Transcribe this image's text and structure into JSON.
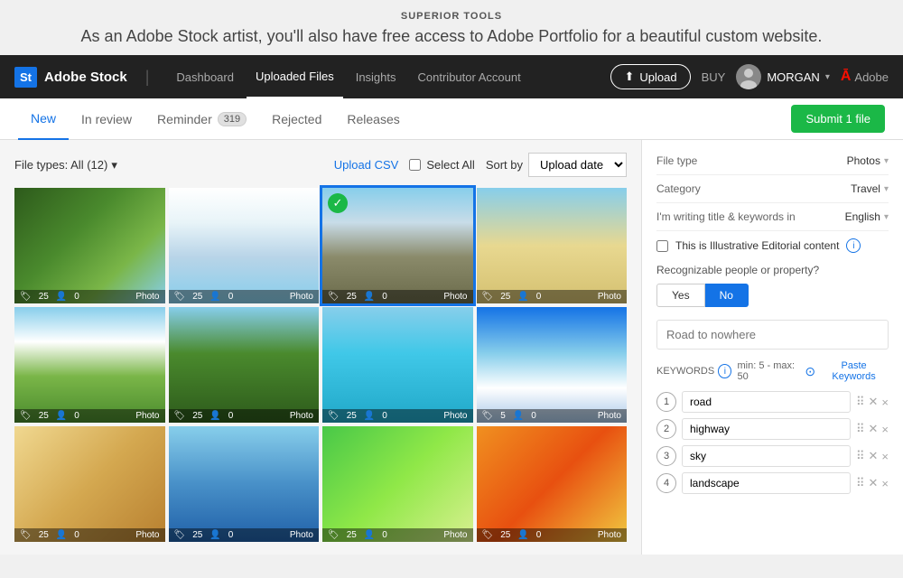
{
  "site": {
    "title": "SUPERIOR TOOLS",
    "tagline": "As an Adobe Stock artist, you'll also have free access to Adobe Portfolio for a beautiful custom website."
  },
  "header": {
    "logo_text": "St",
    "brand_name": "Adobe Stock",
    "nav_items": [
      {
        "label": "Dashboard",
        "active": false
      },
      {
        "label": "Uploaded Files",
        "active": true
      },
      {
        "label": "Insights",
        "active": false
      },
      {
        "label": "Contributor Account",
        "active": false
      }
    ],
    "upload_btn": "Upload",
    "buy_link": "BUY",
    "user_name": "MORGAN",
    "adobe_label": "Adobe"
  },
  "tabs": {
    "items": [
      {
        "label": "New",
        "active": true,
        "badge": null
      },
      {
        "label": "In review",
        "active": false,
        "badge": null
      },
      {
        "label": "Reminder",
        "active": false,
        "badge": "319"
      },
      {
        "label": "Rejected",
        "active": false,
        "badge": null
      },
      {
        "label": "Releases",
        "active": false,
        "badge": null
      }
    ],
    "submit_btn": "Submit 1 file"
  },
  "filters": {
    "file_types": "File types: All (12)",
    "upload_csv": "Upload CSV",
    "select_all": "Select All",
    "sort_by_label": "Sort by",
    "sort_option": "Upload date"
  },
  "images": [
    {
      "id": 1,
      "style": "img-forest",
      "tags": 25,
      "people": 0,
      "type": "Photo",
      "selected": false
    },
    {
      "id": 2,
      "style": "img-sky-plane",
      "tags": 25,
      "people": 0,
      "type": "Photo",
      "selected": false
    },
    {
      "id": 3,
      "style": "img-road",
      "tags": 25,
      "people": 0,
      "type": "Photo",
      "selected": true
    },
    {
      "id": 4,
      "style": "img-desert",
      "tags": 25,
      "people": 0,
      "type": "Photo",
      "selected": false
    },
    {
      "id": 5,
      "style": "img-field",
      "tags": 25,
      "people": 0,
      "type": "Photo",
      "selected": false
    },
    {
      "id": 6,
      "style": "img-palms",
      "tags": 25,
      "people": 0,
      "type": "Photo",
      "selected": false
    },
    {
      "id": 7,
      "style": "img-pool",
      "tags": 25,
      "people": 0,
      "type": "Photo",
      "selected": false
    },
    {
      "id": 8,
      "style": "img-ski",
      "tags": 5,
      "people": 0,
      "type": "Photo",
      "selected": false
    },
    {
      "id": 9,
      "style": "img-room",
      "tags": 25,
      "people": 0,
      "type": "Photo",
      "selected": false
    },
    {
      "id": 10,
      "style": "img-blue",
      "tags": 25,
      "people": 0,
      "type": "Photo",
      "selected": false
    },
    {
      "id": 11,
      "style": "img-green",
      "tags": 25,
      "people": 0,
      "type": "Photo",
      "selected": false
    },
    {
      "id": 12,
      "style": "img-orange",
      "tags": 25,
      "people": 0,
      "type": "Photo",
      "selected": false
    }
  ],
  "right_panel": {
    "file_type_label": "File type",
    "file_type_value": "Photos",
    "category_label": "Category",
    "category_value": "Travel",
    "language_label": "I'm writing title & keywords in",
    "language_value": "English",
    "illustrative_label": "This is Illustrative Editorial content",
    "recognizable_label": "Recognizable people or property?",
    "yes_label": "Yes",
    "no_label": "No",
    "title_placeholder": "Road to nowhere",
    "keywords_label": "KEYWORDS",
    "keywords_hint": "min: 5 - max: 50",
    "paste_keywords": "Paste Keywords",
    "keywords": [
      {
        "num": 1,
        "value": "road"
      },
      {
        "num": 2,
        "value": "highway"
      },
      {
        "num": 3,
        "value": "sky"
      },
      {
        "num": 4,
        "value": "landscape"
      }
    ]
  }
}
